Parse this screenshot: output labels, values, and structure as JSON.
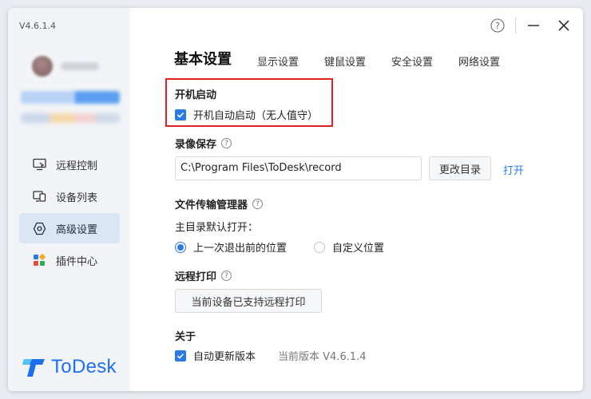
{
  "sidebar": {
    "version": "V4.6.1.4",
    "nav": [
      {
        "label": "远程控制",
        "icon": "remote-control-icon"
      },
      {
        "label": "设备列表",
        "icon": "device-list-icon"
      },
      {
        "label": "高级设置",
        "icon": "advanced-settings-icon"
      },
      {
        "label": "插件中心",
        "icon": "plugin-center-icon"
      }
    ],
    "active_index": 2,
    "logo_text": "ToDesk"
  },
  "window_controls": {
    "help": "?",
    "minimize": "—",
    "close": "✕"
  },
  "tabs": [
    {
      "label": "基本设置",
      "active": true
    },
    {
      "label": "显示设置"
    },
    {
      "label": "键鼠设置"
    },
    {
      "label": "安全设置"
    },
    {
      "label": "网络设置"
    }
  ],
  "startup": {
    "title": "开机启动",
    "checkbox_label": "开机自动启动（无人值守）",
    "checked": true
  },
  "record": {
    "title": "录像保存",
    "path": "C:\\Program Files\\ToDesk\\record",
    "change_dir_label": "更改目录",
    "open_label": "打开"
  },
  "file_transfer": {
    "title": "文件传输管理器",
    "default_open_label": "主目录默认打开：",
    "options": [
      "上一次退出前的位置",
      "自定义位置"
    ],
    "selected_index": 0
  },
  "remote_print": {
    "title": "远程打印",
    "button_label": "当前设备已支持远程打印"
  },
  "about": {
    "title": "关于",
    "auto_update_label": "自动更新版本",
    "auto_update_checked": true,
    "current_version_label": "当前版本 V4.6.1.4"
  },
  "colors": {
    "accent": "#2a7ae8",
    "highlight": "#e31e24",
    "logo": "#1d6ff2"
  }
}
